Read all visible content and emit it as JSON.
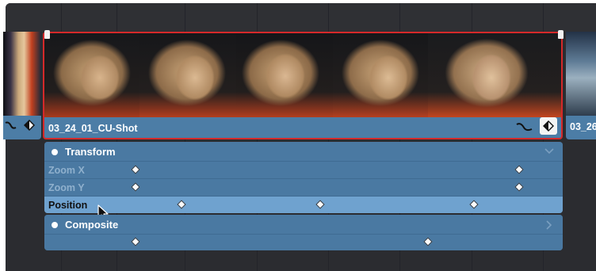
{
  "clips": {
    "current": {
      "name": "03_24_01_CU-Shot"
    },
    "next": {
      "name": "03_26"
    }
  },
  "icons": {
    "curve": "curve-icon",
    "keyframe_toggle": "keyframe-toggle-icon",
    "chevron_down": "chevron-down-icon",
    "chevron_right": "chevron-right-icon",
    "cursor": "mouse-cursor-icon"
  },
  "keyframe_panel": {
    "transform": {
      "title": "Transform",
      "params": [
        {
          "label": "Zoom X",
          "state": "dimmed"
        },
        {
          "label": "Zoom Y",
          "state": "dimmed"
        },
        {
          "label": "Position",
          "state": "selected"
        }
      ]
    },
    "composite": {
      "title": "Composite"
    }
  },
  "colors": {
    "selection_outline": "#d5292a",
    "clip_blue": "#4c7da6",
    "row_selected": "#6fa2cf"
  }
}
